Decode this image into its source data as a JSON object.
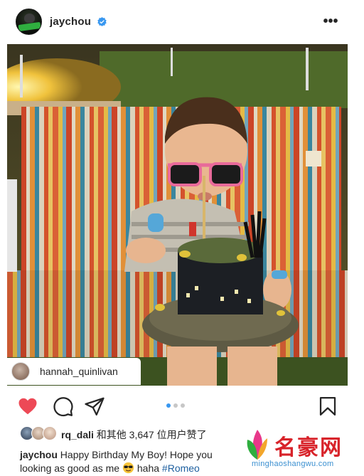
{
  "post": {
    "username": "jaychou",
    "verified": true,
    "more_icon": "more-horizontal-icon"
  },
  "photo": {
    "subject": "child-with-birthday-cake",
    "tagged_user": "hannah_quinlivan",
    "carousel": {
      "total": 3,
      "current": 1
    }
  },
  "actions": {
    "like_icon": "heart-icon-filled",
    "like_color": "#ed4956",
    "comment_icon": "comment-icon",
    "share_icon": "send-icon",
    "save_icon": "bookmark-icon"
  },
  "likes": {
    "text_user": "rq_dali",
    "text_rest": " 和其他 3,647 位用户赞了"
  },
  "caption": {
    "username": "jaychou",
    "text_part1": " Happy Birthday My Boy! Hope you",
    "text_part2": "looking as good as me ",
    "emoji": "sunglasses-emoji",
    "text_part3": " haha ",
    "hashtag": "#Romeo"
  },
  "watermark": {
    "title": "名豪网",
    "url": "minghaoshangwu.com"
  },
  "colors": {
    "accent": "#3897f0",
    "hashtag": "#1d5f9f",
    "watermark_red": "#d8232a",
    "watermark_blue": "#3a8fd0"
  }
}
